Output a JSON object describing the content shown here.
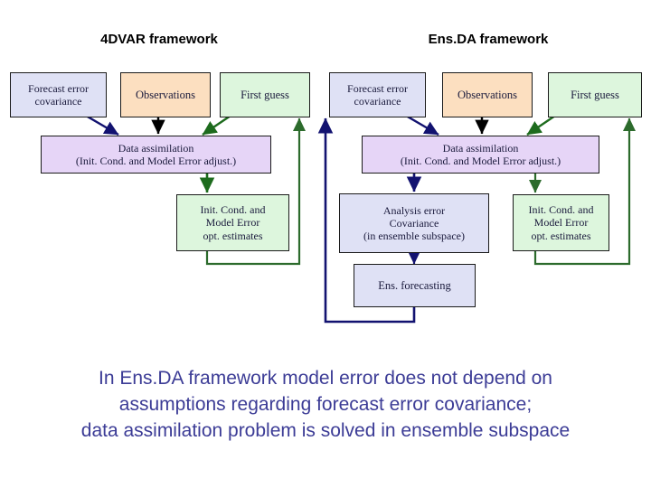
{
  "slide": {
    "background_color": "#ffffff",
    "panels": [
      {
        "title": "4DVAR framework"
      },
      {
        "title": "Ens.DA framework"
      }
    ],
    "nodes": {
      "left_forecast_error_covariance": "Forecast error\ncovariance",
      "left_observations": "Observations",
      "left_first_guess": "First guess",
      "left_data_assimilation": "Data assimilation\n(Init. Cond. and Model Error adjust.)",
      "left_opt_estimates": "Init. Cond. and\nModel Error\nopt. estimates",
      "right_forecast_error_covariance": "Forecast error\ncovariance",
      "right_observations": "Observations",
      "right_first_guess": "First guess",
      "right_data_assimilation": "Data assimilation\n(Init. Cond. and Model Error adjust.)",
      "right_analysis_error_covariance": "Analysis error\nCovariance\n(in ensemble subspace)",
      "right_opt_estimates": "Init. Cond. and\nModel Error\nopt. estimates",
      "right_ens_forecasting": "Ens. forecasting"
    },
    "caption": {
      "line1": "In Ens.DA framework model error does not depend on",
      "line2": "assumptions regarding forecast error covariance;",
      "line3": "data assimilation problem is solved in ensemble subspace",
      "color": "#3c3c96"
    },
    "colors": {
      "box_blue_fill": "#dfe1f5",
      "box_orange_fill": "#fcdfc0",
      "box_green_fill": "#ddf6dd",
      "box_purple_fill": "#e6d5f7",
      "arrow_navy": "#121270",
      "arrow_black": "#000000",
      "arrow_green": "#1d6b1d",
      "arrow_dark_green": "#2c6b2c",
      "box_border": "#1a1a1a",
      "title_text": "#000000"
    },
    "arrows": [
      {
        "name": "left-covariance-to-da",
        "color": "#121270",
        "from": "left_forecast_error_covariance",
        "to": "left_data_assimilation"
      },
      {
        "name": "left-observations-to-da",
        "color": "#000000",
        "from": "left_observations",
        "to": "left_data_assimilation"
      },
      {
        "name": "left-first-guess-to-da",
        "color": "#1d6b1d",
        "from": "left_first_guess",
        "to": "left_data_assimilation"
      },
      {
        "name": "left-da-to-opt-estimates",
        "color": "#1d6b1d",
        "from": "left_data_assimilation",
        "to": "left_opt_estimates"
      },
      {
        "name": "left-opt-estimates-to-first-guess-loop",
        "color": "#2c6b2c",
        "from": "left_opt_estimates",
        "to": "left_first_guess"
      },
      {
        "name": "right-covariance-to-da",
        "color": "#121270",
        "from": "right_forecast_error_covariance",
        "to": "right_data_assimilation"
      },
      {
        "name": "right-observations-to-da",
        "color": "#000000",
        "from": "right_observations",
        "to": "right_data_assimilation"
      },
      {
        "name": "right-first-guess-to-da",
        "color": "#1d6b1d",
        "from": "right_first_guess",
        "to": "right_data_assimilation"
      },
      {
        "name": "right-da-to-analysis-error-covariance",
        "color": "#121270",
        "from": "right_data_assimilation",
        "to": "right_analysis_error_covariance"
      },
      {
        "name": "right-da-to-opt-estimates",
        "color": "#2c6b2c",
        "from": "right_data_assimilation",
        "to": "right_opt_estimates"
      },
      {
        "name": "right-analysis-covariance-to-ens-forecasting",
        "color": "#121270",
        "from": "right_analysis_error_covariance",
        "to": "right_ens_forecasting"
      },
      {
        "name": "right-ens-forecasting-to-covariance-loop",
        "color": "#121270",
        "from": "right_ens_forecasting",
        "to": "right_forecast_error_covariance"
      },
      {
        "name": "right-opt-estimates-to-first-guess-loop",
        "color": "#2c6b2c",
        "from": "right_opt_estimates",
        "to": "right_first_guess"
      }
    ]
  }
}
